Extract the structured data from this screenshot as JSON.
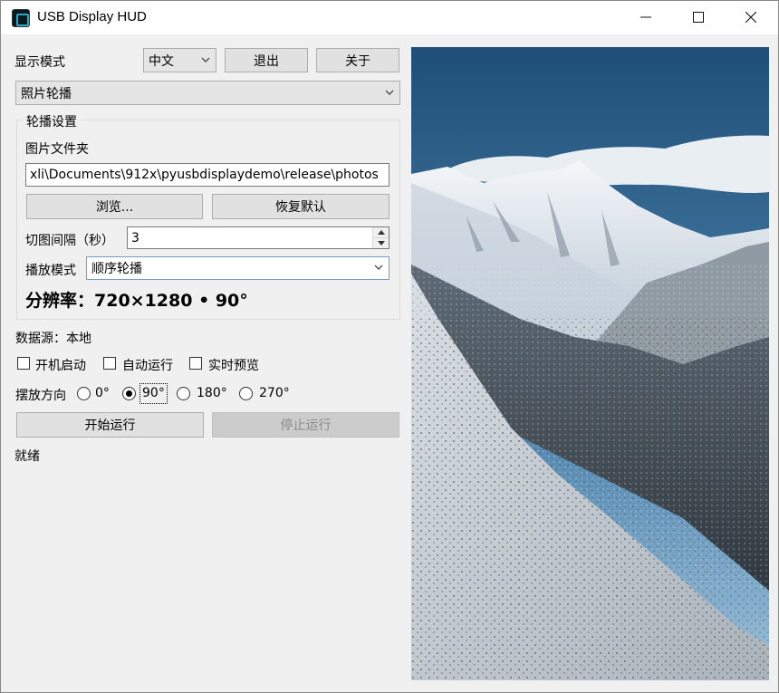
{
  "window": {
    "title": "USB Display HUD"
  },
  "icons": {
    "app": "app-icon",
    "minimize": "minimize-icon",
    "maximize": "maximize-icon",
    "close": "close-icon",
    "dropdown": "chevron-down-icon"
  },
  "top": {
    "display_mode_label": "显示模式",
    "language_value": "中文",
    "exit_label": "退出",
    "about_label": "关于",
    "mode_value": "照片轮播"
  },
  "slideshow": {
    "group_title": "轮播设置",
    "folder_label": "图片文件夹",
    "folder_value": "xli\\Documents\\912x\\pyusbdisplaydemo\\release\\photos",
    "browse_label": "浏览...",
    "reset_label": "恢复默认",
    "interval_label": "切图间隔（秒）",
    "interval_value": "3",
    "play_mode_label": "播放模式",
    "play_mode_value": "顺序轮播",
    "resolution_text": "分辨率：720×1280 • 90°"
  },
  "status": {
    "data_source": "数据源：本地",
    "autostart_label": "开机启动",
    "autorun_label": "自动运行",
    "preview_label": "实时预览",
    "orientation_label": "摆放方向",
    "orientations": [
      "0°",
      "90°",
      "180°",
      "270°"
    ],
    "selected_orientation": "90°",
    "start_label": "开始运行",
    "stop_label": "停止运行",
    "state_text": "就绪"
  },
  "colors": {
    "window_bg": "#f0f0f0",
    "sky": "#2a5a80",
    "snow": "#eef2f5",
    "mountain_dark": "#3c4650"
  }
}
